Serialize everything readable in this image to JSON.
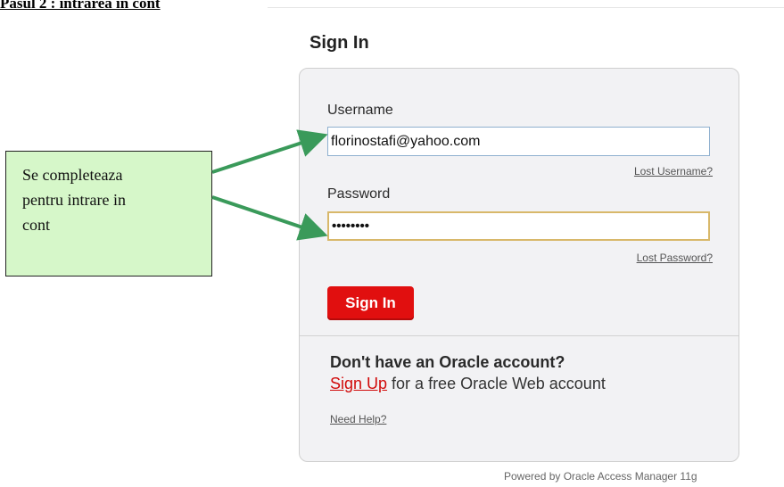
{
  "document": {
    "heading": "Pasul 2 : intrarea in cont"
  },
  "signin": {
    "title": "Sign In",
    "username_label": "Username",
    "username_value": "florinostafi@yahoo.com",
    "lost_username": "Lost Username?",
    "password_label": "Password",
    "password_value": "••••••••",
    "lost_password": "Lost Password?",
    "button_label": "Sign In",
    "no_account_heading": "Don't have an Oracle account?",
    "signup_link": "Sign Up",
    "signup_text": " for a free Oracle Web account",
    "need_help": "Need Help?",
    "powered_by": "Powered by Oracle Access Manager 11g"
  },
  "callout": {
    "lines": [
      "Se completeaza",
      "pentru intrare in",
      "cont"
    ]
  },
  "colors": {
    "callout_bg": "#d6f7c9",
    "arrow": "#3a9a5a",
    "button_red": "#e10f0f",
    "link_red": "#d10a0a"
  }
}
